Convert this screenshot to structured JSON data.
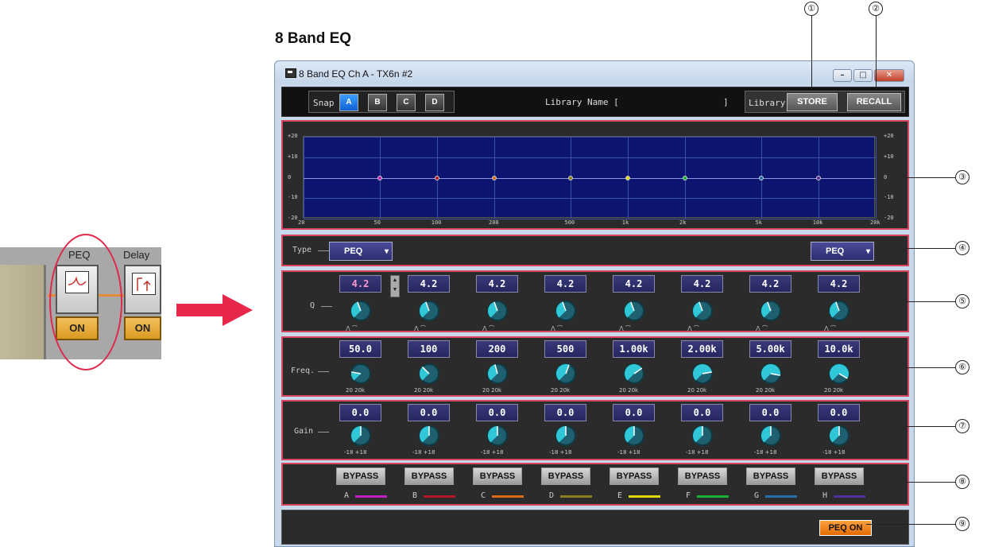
{
  "doc_title": "8 Band EQ",
  "source_panel": {
    "blocks": [
      {
        "label": "PEQ",
        "button": "ON"
      },
      {
        "label": "Delay",
        "button": "ON"
      }
    ]
  },
  "window": {
    "title": "8 Band EQ  Ch A - TX6n #2",
    "snap_label": "Snap",
    "snaps": [
      "A",
      "B",
      "C",
      "D"
    ],
    "selected_snap": "A",
    "library_name_label": "Library Name [",
    "library_name_close": "]",
    "library_label": "Library",
    "store_label": "STORE",
    "recall_label": "RECALL",
    "graph": {
      "y_ticks": [
        "+20",
        "+10",
        "0",
        "-10",
        "-20"
      ],
      "x_ticks": [
        "20",
        "50",
        "100",
        "200",
        "500",
        "1k",
        "2k",
        "5k",
        "10k",
        "20k"
      ]
    },
    "type_label": "Type",
    "type_values": [
      "PEQ",
      "PEQ"
    ],
    "q_label": "Q",
    "q_values": [
      "4.2",
      "4.2",
      "4.2",
      "4.2",
      "4.2",
      "4.2",
      "4.2",
      "4.2"
    ],
    "freq_label": "Freq.",
    "freq_values": [
      "50.0",
      "100",
      "200",
      "500",
      "1.00k",
      "2.00k",
      "5.00k",
      "10.0k"
    ],
    "freq_min": "20",
    "freq_max": "20k",
    "gain_label": "Gain",
    "gain_values": [
      "0.0",
      "0.0",
      "0.0",
      "0.0",
      "0.0",
      "0.0",
      "0.0",
      "0.0"
    ],
    "gain_min": "-18",
    "gain_max": "+18",
    "bypass_label": "BYPASS",
    "bands": [
      {
        "name": "A",
        "color": "#c020c0"
      },
      {
        "name": "B",
        "color": "#b01828"
      },
      {
        "name": "C",
        "color": "#d86a18"
      },
      {
        "name": "D",
        "color": "#8a8020"
      },
      {
        "name": "E",
        "color": "#e0d800"
      },
      {
        "name": "F",
        "color": "#18b030"
      },
      {
        "name": "G",
        "color": "#2070b0"
      },
      {
        "name": "H",
        "color": "#5030a0"
      }
    ],
    "peq_on_label": "PEQ ON"
  },
  "callouts": [
    "①",
    "②",
    "③",
    "④",
    "⑤",
    "⑥",
    "⑦",
    "⑧",
    "⑨"
  ],
  "colors": {
    "highlight": "#e0284a",
    "accent_blue": "#1060d0",
    "orange": "#e06c00"
  }
}
